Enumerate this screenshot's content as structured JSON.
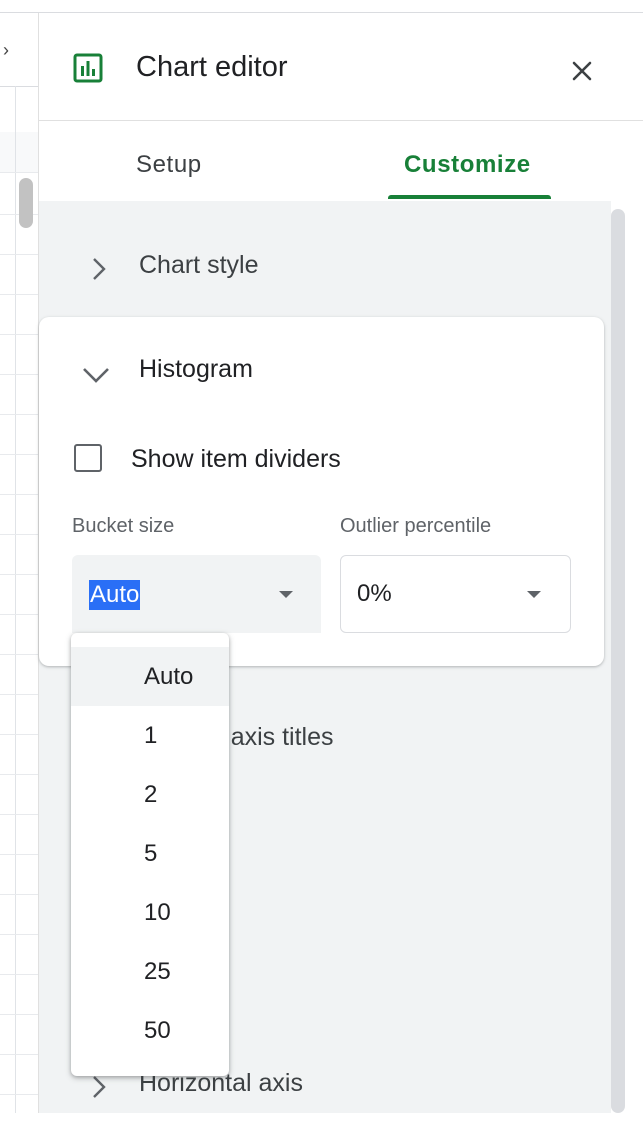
{
  "panel": {
    "title": "Chart editor",
    "tabs": [
      {
        "label": "Setup",
        "active": false
      },
      {
        "label": "Customize",
        "active": true
      }
    ],
    "accent_color": "#188038"
  },
  "sections": {
    "chart_style": "Chart style",
    "histogram": "Histogram",
    "chart_axis_titles": "Chart & axis titles",
    "horizontal_axis": "Horizontal axis"
  },
  "histogram": {
    "show_item_dividers_label": "Show item dividers",
    "show_item_dividers_checked": false,
    "bucket_size_label": "Bucket size",
    "bucket_size_value": "Auto",
    "outlier_percentile_label": "Outlier percentile",
    "outlier_percentile_value": "0%"
  },
  "bucket_menu": {
    "options": [
      "Auto",
      "1",
      "2",
      "5",
      "10",
      "25",
      "50"
    ],
    "selected": "Auto"
  },
  "icons": {
    "chart": "bar-chart-icon",
    "close": "close-icon",
    "expand": "chevron-right-icon",
    "collapse": "chevron-down-icon",
    "dropdown": "caret-down-icon"
  }
}
